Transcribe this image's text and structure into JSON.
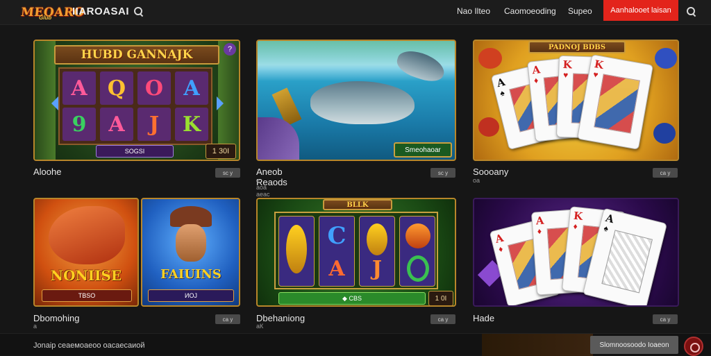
{
  "header": {
    "logo_main": "MEOARO",
    "logo_sub": "Glub",
    "title": "IIAROASAI",
    "nav": [
      "Nao Ilteo",
      "Caomoeoding",
      "Supeo"
    ],
    "cta_label": "Aanhalooet laisan"
  },
  "cards": [
    {
      "title": "Aloohe",
      "badge": "ѕс у",
      "subtitle": "",
      "art": {
        "sign": "HUBD GANNAJK",
        "reels": [
          "A",
          "Q",
          "O",
          "A",
          "9",
          "A",
          "J",
          "K"
        ],
        "plaque": "SOGSI",
        "counter": "1 30I"
      }
    },
    {
      "title": "Aneob Reaods",
      "badge": "ѕс у",
      "subtitle": "е аоа аеас",
      "art": {
        "plaque": "Smeohaoar"
      }
    },
    {
      "title": "Soooany",
      "badge": "са у",
      "subtitle": "оа",
      "art": {
        "sign": "PADNOJ BDBS",
        "cards": [
          {
            "rank": "A",
            "suit": "♠",
            "color": "#111111"
          },
          {
            "rank": "A",
            "suit": "♦",
            "color": "#d42020"
          },
          {
            "rank": "K",
            "suit": "♥",
            "color": "#d42020"
          },
          {
            "rank": "K",
            "suit": "♥",
            "color": "#d42020"
          }
        ]
      }
    },
    {
      "title": "Dbomohing",
      "badge": "са у",
      "subtitle": "а",
      "art": {
        "left_title": "NONIISE",
        "left_plaque": "ТBSO",
        "right_title": "FAIUINS",
        "right_plaque": "ИOJ"
      }
    },
    {
      "title": "Dbehaniong",
      "badge": "са у",
      "subtitle": "аК",
      "art": {
        "sign": "BLLK",
        "reels": [
          "C",
          "A",
          "J"
        ],
        "plaque": "◆ СBS",
        "counter": "1 0I"
      }
    },
    {
      "title": "Hade",
      "badge": "са у",
      "subtitle": "",
      "art": {
        "cards": [
          {
            "rank": "A",
            "suit": "♦",
            "color": "#d42020"
          },
          {
            "rank": "A",
            "suit": "♦",
            "color": "#d42020"
          },
          {
            "rank": "K",
            "suit": "♦",
            "color": "#d42020"
          },
          {
            "rank": "A",
            "suit": "♠",
            "color": "#111111"
          }
        ]
      }
    }
  ],
  "footer": {
    "text": "Jonaip сеаемоаеоо оасаесаиой",
    "button_label": "Slomnoosoodo Ioaeon"
  },
  "colors": {
    "cta": "#e3241b",
    "frame_gold": "#b8862a",
    "badge_bg": "#4a4a4a"
  },
  "icons": {
    "search": "search-icon",
    "chat": "chat-icon"
  }
}
